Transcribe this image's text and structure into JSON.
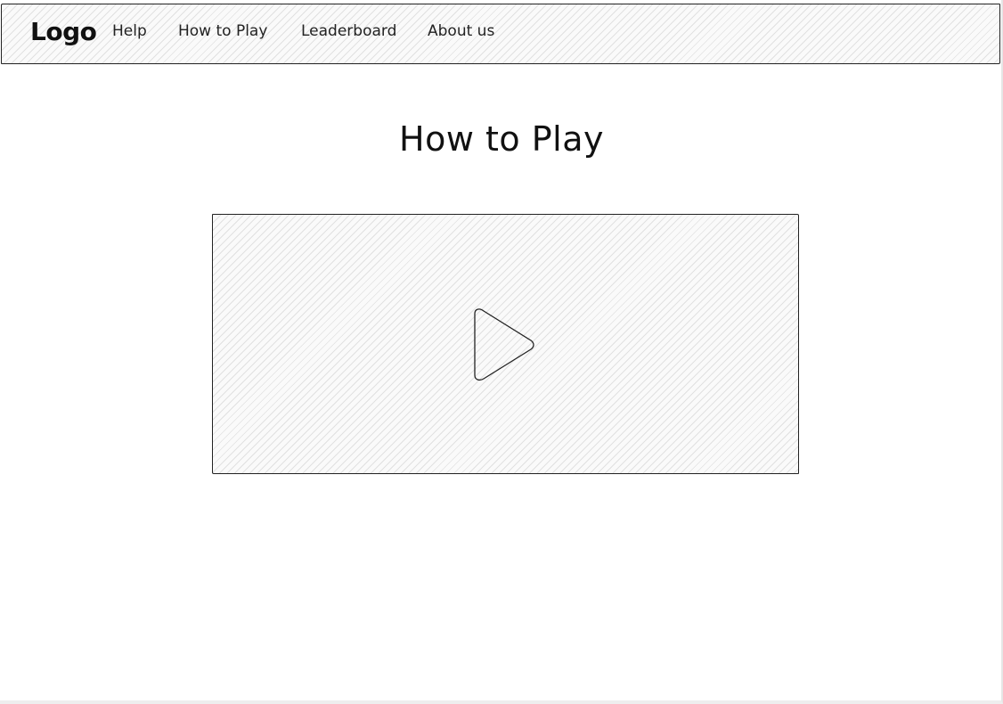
{
  "nav": {
    "logo": "Logo",
    "links": [
      "Help",
      "How to Play",
      "Leaderboard",
      "About us"
    ]
  },
  "main": {
    "title": "How to Play",
    "video": {
      "icon": "play-icon"
    }
  }
}
